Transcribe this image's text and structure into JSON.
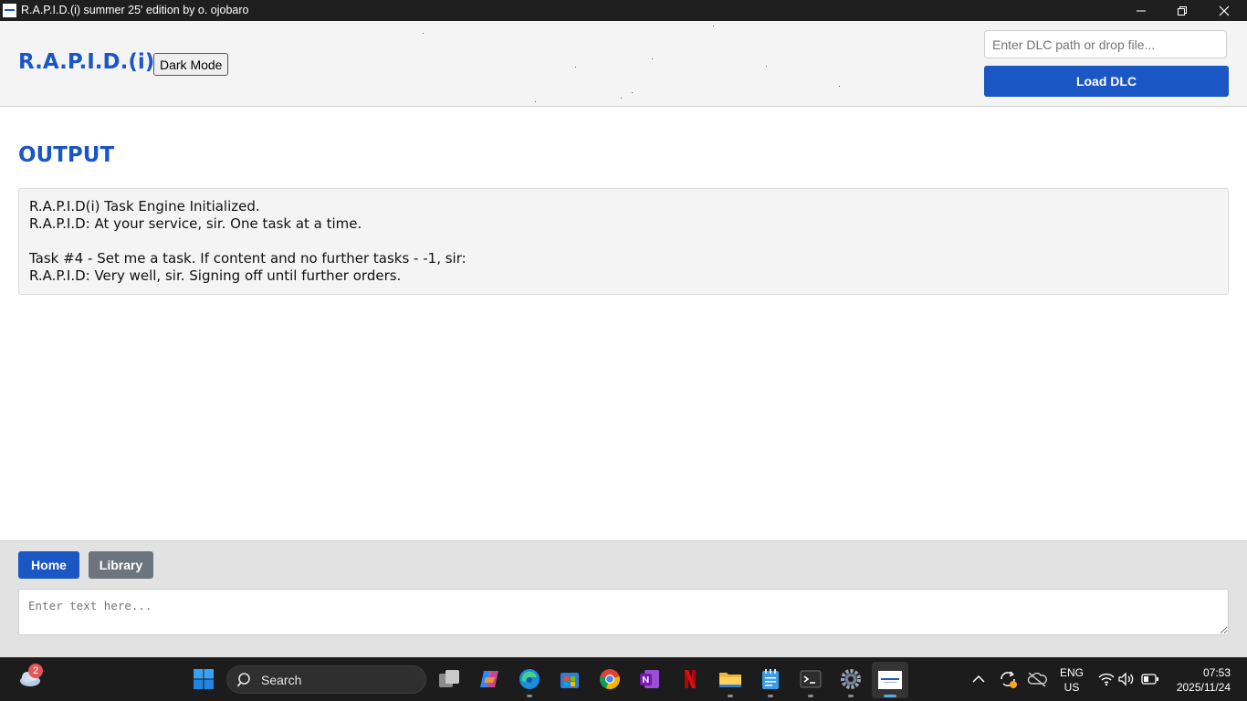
{
  "window": {
    "title": "R.A.P.I.D.(i) summer 25' edition by o. ojobaro"
  },
  "header": {
    "brand": "R.A.P.I.D.(i)",
    "dark_mode_label": "Dark Mode",
    "dlc_placeholder": "Enter DLC path or drop file...",
    "load_dlc_label": "Load DLC"
  },
  "output": {
    "heading": "OUTPUT",
    "lines": [
      "R.A.P.I.D(i) Task Engine Initialized.",
      "R.A.P.I.D: At your service, sir. One task at a time.",
      "",
      "Task #4 - Set me a task. If content and no further tasks - -1, sir:",
      "R.A.P.I.D: Very well, sir. Signing off until further orders."
    ]
  },
  "nav": {
    "home_label": "Home",
    "library_label": "Library"
  },
  "input": {
    "placeholder": "Enter text here..."
  },
  "taskbar": {
    "weather_badge": "2",
    "search_label": "Search",
    "pinned": [
      "task-view",
      "copilot",
      "edge",
      "microsoft-store",
      "chrome",
      "onenote",
      "netflix",
      "file-explorer",
      "notepad",
      "terminal",
      "settings",
      "rapid-app"
    ],
    "language_line1": "ENG",
    "language_line2": "US",
    "time": "07:53",
    "date": "2025/11/24"
  },
  "colors": {
    "accent": "#1a56c4",
    "secondary_button": "#6c757d",
    "taskbar": "#1c1c1c"
  }
}
